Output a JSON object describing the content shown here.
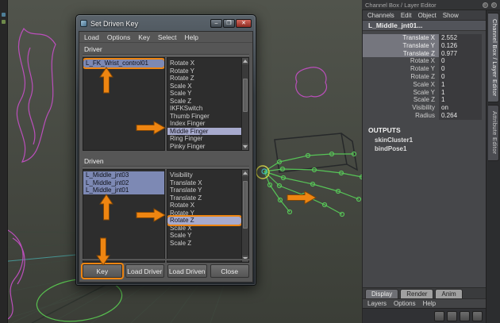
{
  "colors": {
    "annotation_orange": "#ee8511",
    "object_selection": "#7d89b4",
    "attribute_selection": "#a7aacd"
  },
  "right_top": {
    "header": "Channel Box / Layer Editor"
  },
  "dialog": {
    "title": "Set Driven Key",
    "window_controls": [
      {
        "name": "minimize",
        "glyph": "–"
      },
      {
        "name": "maximize",
        "glyph": "❐"
      },
      {
        "name": "close",
        "glyph": "✕"
      }
    ],
    "menu": [
      {
        "label": "Load"
      },
      {
        "label": "Options"
      },
      {
        "label": "Key"
      },
      {
        "label": "Select"
      },
      {
        "label": "Help"
      }
    ],
    "driver": {
      "label": "Driver",
      "objects": [
        {
          "label": "L_FK_Wrist_control01",
          "selected": true,
          "annotated": true
        }
      ],
      "attributes": [
        {
          "label": "Rotate X"
        },
        {
          "label": "Rotate Y"
        },
        {
          "label": "Rotate Z"
        },
        {
          "label": "Scale X"
        },
        {
          "label": "Scale Y"
        },
        {
          "label": "Scale Z"
        },
        {
          "label": "IKFKSwitch"
        },
        {
          "label": "Thumb Finger"
        },
        {
          "label": "Index Finger"
        },
        {
          "label": "Middle Finger",
          "selected": true
        },
        {
          "label": "Ring Finger"
        },
        {
          "label": "Pinky Finger"
        }
      ]
    },
    "driven": {
      "label": "Driven",
      "objects": [
        {
          "label": "L_Middle_jnt03",
          "selected": true
        },
        {
          "label": "L_Middle_jnt02",
          "selected": true
        },
        {
          "label": "L_Middle_jnt01",
          "selected": true
        }
      ],
      "attributes": [
        {
          "label": "Visibility"
        },
        {
          "label": "Translate X"
        },
        {
          "label": "Translate Y"
        },
        {
          "label": "Translate Z"
        },
        {
          "label": "Rotate X"
        },
        {
          "label": "Rotate Y"
        },
        {
          "label": "Rotate Z",
          "selected": true,
          "annotated": true
        },
        {
          "label": "Scale X"
        },
        {
          "label": "Scale Y"
        },
        {
          "label": "Scale Z"
        }
      ]
    },
    "buttons": [
      {
        "label": "Key",
        "annotated": true
      },
      {
        "label": "Load Driver"
      },
      {
        "label": "Load Driven"
      },
      {
        "label": "Close"
      }
    ]
  },
  "channel_box": {
    "menu": [
      {
        "label": "Channels"
      },
      {
        "label": "Edit"
      },
      {
        "label": "Object"
      },
      {
        "label": "Show"
      }
    ],
    "node": "L_Middle_jnt01...",
    "attributes": [
      {
        "name": "Translate X",
        "value": "2.552",
        "highlighted": true
      },
      {
        "name": "Translate Y",
        "value": "0.126",
        "highlighted": true
      },
      {
        "name": "Translate Z",
        "value": "0.977",
        "highlighted": true
      },
      {
        "name": "Rotate X",
        "value": "0"
      },
      {
        "name": "Rotate Y",
        "value": "0"
      },
      {
        "name": "Rotate Z",
        "value": "0"
      },
      {
        "name": "Scale X",
        "value": "1"
      },
      {
        "name": "Scale Y",
        "value": "1"
      },
      {
        "name": "Scale Z",
        "value": "1"
      },
      {
        "name": "Visibility",
        "value": "on"
      },
      {
        "name": "Radius",
        "value": "0.264"
      }
    ],
    "outputs_label": "OUTPUTS",
    "outputs": [
      "skinCluster1",
      "bindPose1"
    ],
    "side_tabs": [
      {
        "label": "Channel Box / Layer Editor",
        "active": true
      },
      {
        "label": "Attribute Editor"
      }
    ],
    "bottom_tabs": [
      {
        "label": "Display",
        "active": true
      },
      {
        "label": "Render"
      },
      {
        "label": "Anim"
      }
    ],
    "layer_menu": [
      {
        "label": "Layers"
      },
      {
        "label": "Options"
      },
      {
        "label": "Help"
      }
    ]
  }
}
